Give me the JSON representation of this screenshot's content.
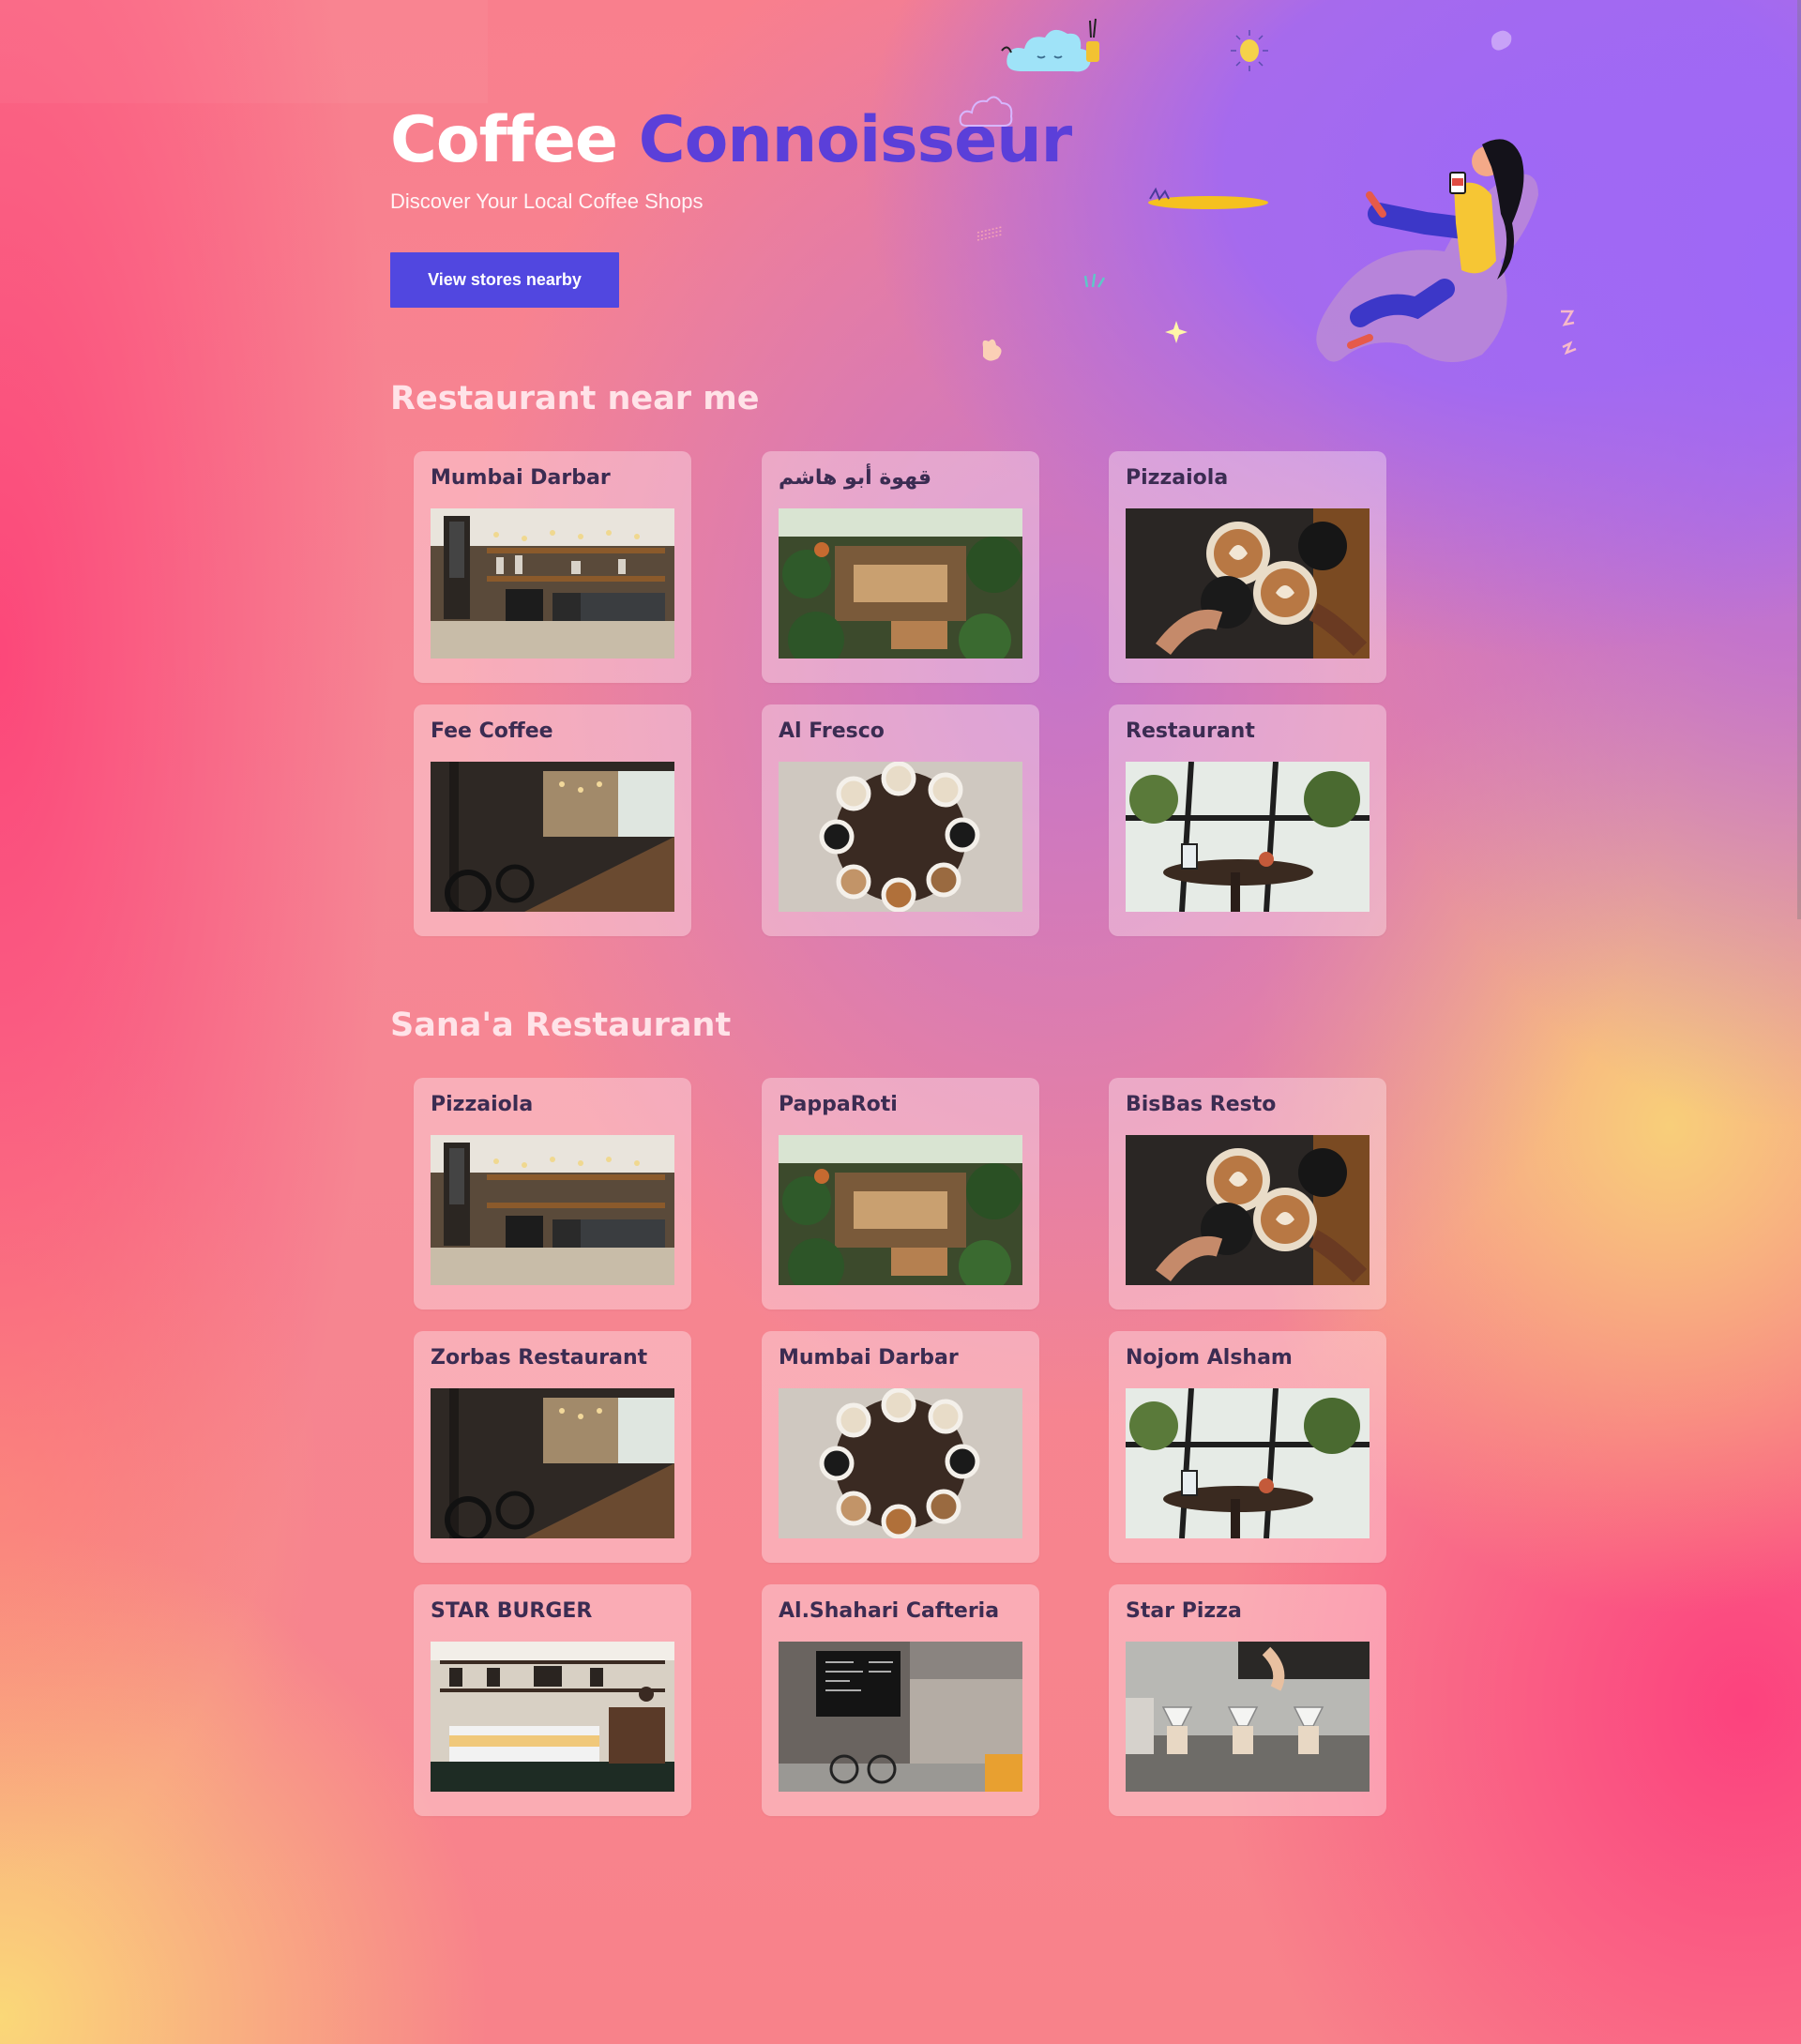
{
  "hero": {
    "title_part1": "Coffee",
    "title_part2": "Connoisseur",
    "subtitle": "Discover Your Local Coffee Shops",
    "cta_label": "View stores nearby"
  },
  "colors": {
    "accent": "#5b3fd9",
    "button": "#5147e0",
    "card_title": "#3b2c52"
  },
  "sections": [
    {
      "title": "Restaurant near me",
      "cards": [
        {
          "name": "Mumbai Darbar",
          "image": "cafe-counter"
        },
        {
          "name": "قهوة أبو هاشم",
          "image": "garden-cafe"
        },
        {
          "name": "Pizzaiola",
          "image": "latte-cheers"
        },
        {
          "name": "Fee Coffee",
          "image": "cafe-hall"
        },
        {
          "name": "Al Fresco",
          "image": "cups-table"
        },
        {
          "name": "Restaurant",
          "image": "window-table"
        }
      ]
    },
    {
      "title": "Sana'a Restaurant",
      "cards": [
        {
          "name": "Pizzaiola",
          "image": "cafe-counter"
        },
        {
          "name": "PappaRoti",
          "image": "garden-cafe"
        },
        {
          "name": "BisBas Resto",
          "image": "latte-cheers"
        },
        {
          "name": "Zorbas Restaurant",
          "image": "cafe-hall"
        },
        {
          "name": "Mumbai Darbar",
          "image": "cups-table"
        },
        {
          "name": "Nojom Alsham",
          "image": "window-table"
        },
        {
          "name": "STAR BURGER",
          "image": "bakery-counter"
        },
        {
          "name": "Al.Shahari Cafteria",
          "image": "menu-board-cafe"
        },
        {
          "name": "Star Pizza",
          "image": "pour-over"
        }
      ]
    }
  ]
}
